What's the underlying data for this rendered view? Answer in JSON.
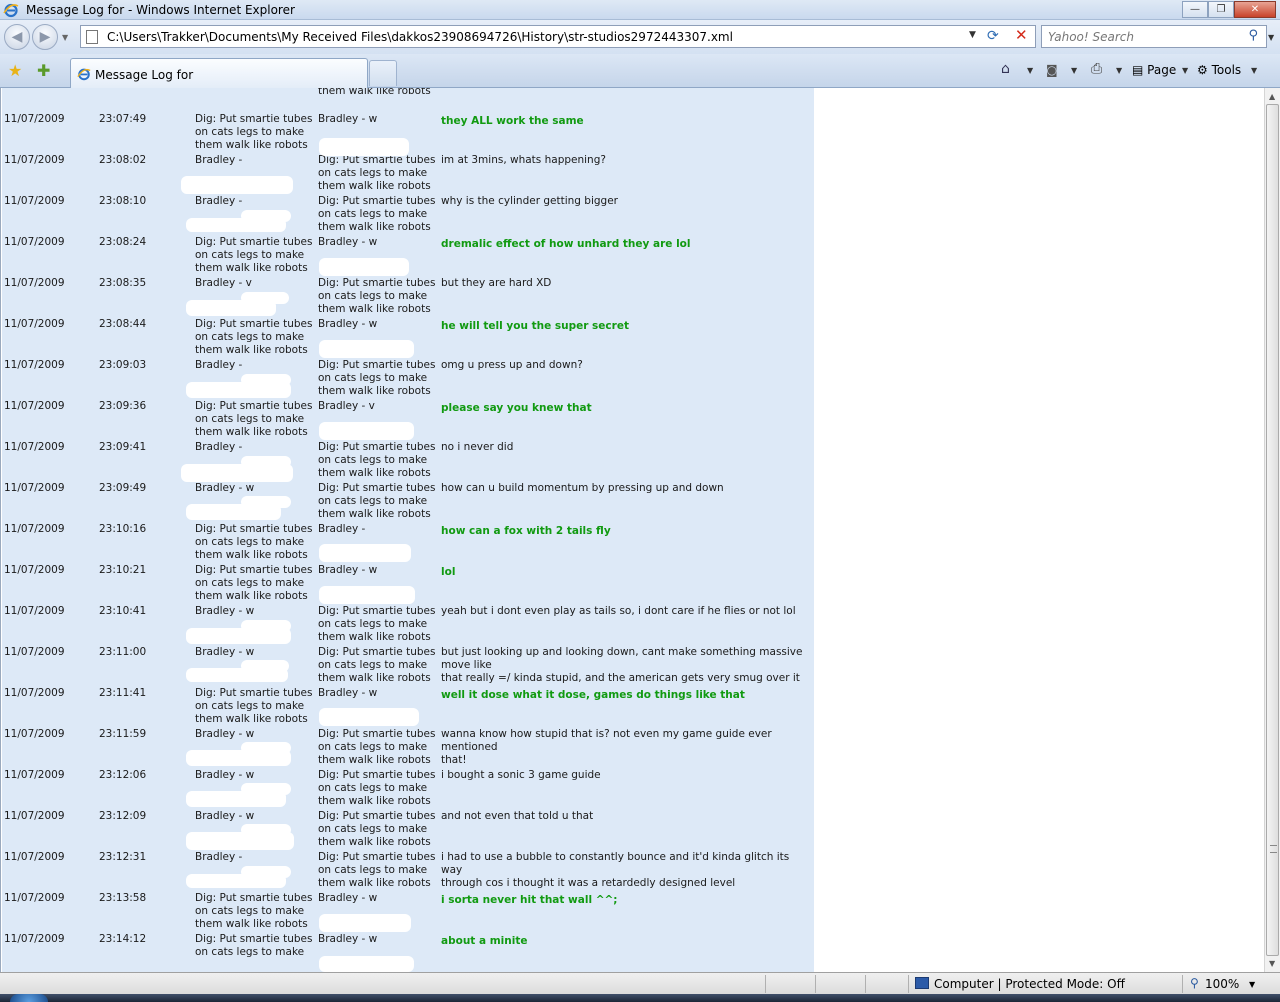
{
  "window": {
    "title": "Message Log for - Windows Internet Explorer",
    "minimize_icon": "minimize-icon",
    "maximize_icon": "maximize-icon",
    "close_icon": "close-icon"
  },
  "address_bar": {
    "url": "C:\\Users\\Trakker\\Documents\\My Received Files\\dakkos23908694726\\History\\str-studios2972443307.xml"
  },
  "search": {
    "placeholder": "Yahoo! Search"
  },
  "tabs": [
    {
      "label": "Message Log for"
    }
  ],
  "command_bar": {
    "page_label": "Page",
    "tools_label": "Tools"
  },
  "log": {
    "rows": [
      {
        "date": "",
        "time": "",
        "from": "",
        "to": "on cats legs to make\nthem walk like robots",
        "message": "",
        "green": false
      },
      {
        "date": "11/07/2009",
        "time": "23:07:49",
        "from": "Dig: Put smartie tubes\non cats legs to make\nthem walk like robots",
        "to": "Bradley - w",
        "message": "they ALL work the same",
        "green": true
      },
      {
        "date": "11/07/2009",
        "time": "23:08:02",
        "from": "Bradley -",
        "to": "Dig: Put smartie tubes\non cats legs to make\nthem walk like robots",
        "message": "im at 3mins, whats happening?",
        "green": false
      },
      {
        "date": "11/07/2009",
        "time": "23:08:10",
        "from": "Bradley -",
        "to": "Dig: Put smartie tubes\non cats legs to make\nthem walk like robots",
        "message": "why is the cylinder getting bigger",
        "green": false
      },
      {
        "date": "11/07/2009",
        "time": "23:08:24",
        "from": "Dig: Put smartie tubes\non cats legs to make\nthem walk like robots",
        "to": "Bradley - w",
        "message": "dremalic effect of how unhard they are lol",
        "green": true
      },
      {
        "date": "11/07/2009",
        "time": "23:08:35",
        "from": "Bradley - v",
        "to": "Dig: Put smartie tubes\non cats legs to make\nthem walk like robots",
        "message": "but they are hard XD",
        "green": false
      },
      {
        "date": "11/07/2009",
        "time": "23:08:44",
        "from": "Dig: Put smartie tubes\non cats legs to make\nthem walk like robots",
        "to": "Bradley - w",
        "message": "he will tell you the super secret",
        "green": true
      },
      {
        "date": "11/07/2009",
        "time": "23:09:03",
        "from": "Bradley -",
        "to": "Dig: Put smartie tubes\non cats legs to make\nthem walk like robots",
        "message": "omg u press up and down?",
        "green": false
      },
      {
        "date": "11/07/2009",
        "time": "23:09:36",
        "from": "Dig: Put smartie tubes\non cats legs to make\nthem walk like robots",
        "to": "Bradley - v",
        "message": "please say you knew that",
        "green": true
      },
      {
        "date": "11/07/2009",
        "time": "23:09:41",
        "from": "Bradley -",
        "to": "Dig: Put smartie tubes\non cats legs to make\nthem walk like robots",
        "message": "no i never did",
        "green": false
      },
      {
        "date": "11/07/2009",
        "time": "23:09:49",
        "from": "Bradley - w",
        "to": "Dig: Put smartie tubes\non cats legs to make\nthem walk like robots",
        "message": "how can u build momentum by pressing up and down",
        "green": false
      },
      {
        "date": "11/07/2009",
        "time": "23:10:16",
        "from": "Dig: Put smartie tubes\non cats legs to make\nthem walk like robots",
        "to": "Bradley -",
        "message": "how can a fox with 2 tails fly",
        "green": true
      },
      {
        "date": "11/07/2009",
        "time": "23:10:21",
        "from": "Dig: Put smartie tubes\non cats legs to make\nthem walk like robots",
        "to": "Bradley - w",
        "message": "lol",
        "green": true
      },
      {
        "date": "11/07/2009",
        "time": "23:10:41",
        "from": "Bradley - w",
        "to": "Dig: Put smartie tubes\non cats legs to make\nthem walk like robots",
        "message": "yeah but i dont even play as tails so, i dont care if he flies or not lol",
        "green": false
      },
      {
        "date": "11/07/2009",
        "time": "23:11:00",
        "from": "Bradley - w",
        "to": "Dig: Put smartie tubes\non cats legs to make\nthem walk like robots",
        "message": "but just looking up and looking down, cant make something massive move like\nthat really =/ kinda stupid, and the american gets very smug over it",
        "green": false
      },
      {
        "date": "11/07/2009",
        "time": "23:11:41",
        "from": "Dig: Put smartie tubes\non cats legs to make\nthem walk like robots",
        "to": "Bradley - w",
        "message": "well it dose what it dose, games do things like that",
        "green": true
      },
      {
        "date": "11/07/2009",
        "time": "23:11:59",
        "from": "Bradley - w",
        "to": "Dig: Put smartie tubes\non cats legs to make\nthem walk like robots",
        "message": "wanna know how stupid that is? not even my game guide ever mentioned\nthat!",
        "green": false
      },
      {
        "date": "11/07/2009",
        "time": "23:12:06",
        "from": "Bradley - w",
        "to": "Dig: Put smartie tubes\non cats legs to make\nthem walk like robots",
        "message": "i bought a sonic 3 game guide",
        "green": false
      },
      {
        "date": "11/07/2009",
        "time": "23:12:09",
        "from": "Bradley - w",
        "to": "Dig: Put smartie tubes\non cats legs to make\nthem walk like robots",
        "message": "and not even that told u that",
        "green": false
      },
      {
        "date": "11/07/2009",
        "time": "23:12:31",
        "from": "Bradley -",
        "to": "Dig: Put smartie tubes\non cats legs to make\nthem walk like robots",
        "message": "i had to use a bubble to constantly bounce and it'd kinda glitch its way\nthrough cos i thought it was a retardedly designed level",
        "green": false
      },
      {
        "date": "11/07/2009",
        "time": "23:13:58",
        "from": "Dig: Put smartie tubes\non cats legs to make\nthem walk like robots",
        "to": "Bradley - w",
        "message": "i sorta never hit that wall ^^;",
        "green": true
      },
      {
        "date": "11/07/2009",
        "time": "23:14:12",
        "from": "Dig: Put smartie tubes\non cats legs to make",
        "to": "Bradley - w",
        "message": "about a minite",
        "green": true
      }
    ]
  },
  "status_bar": {
    "zone": "Computer | Protected Mode: Off",
    "zoom": "100%"
  },
  "colors": {
    "log_background": "#dde9f7",
    "highlight_message": "#119a11"
  }
}
